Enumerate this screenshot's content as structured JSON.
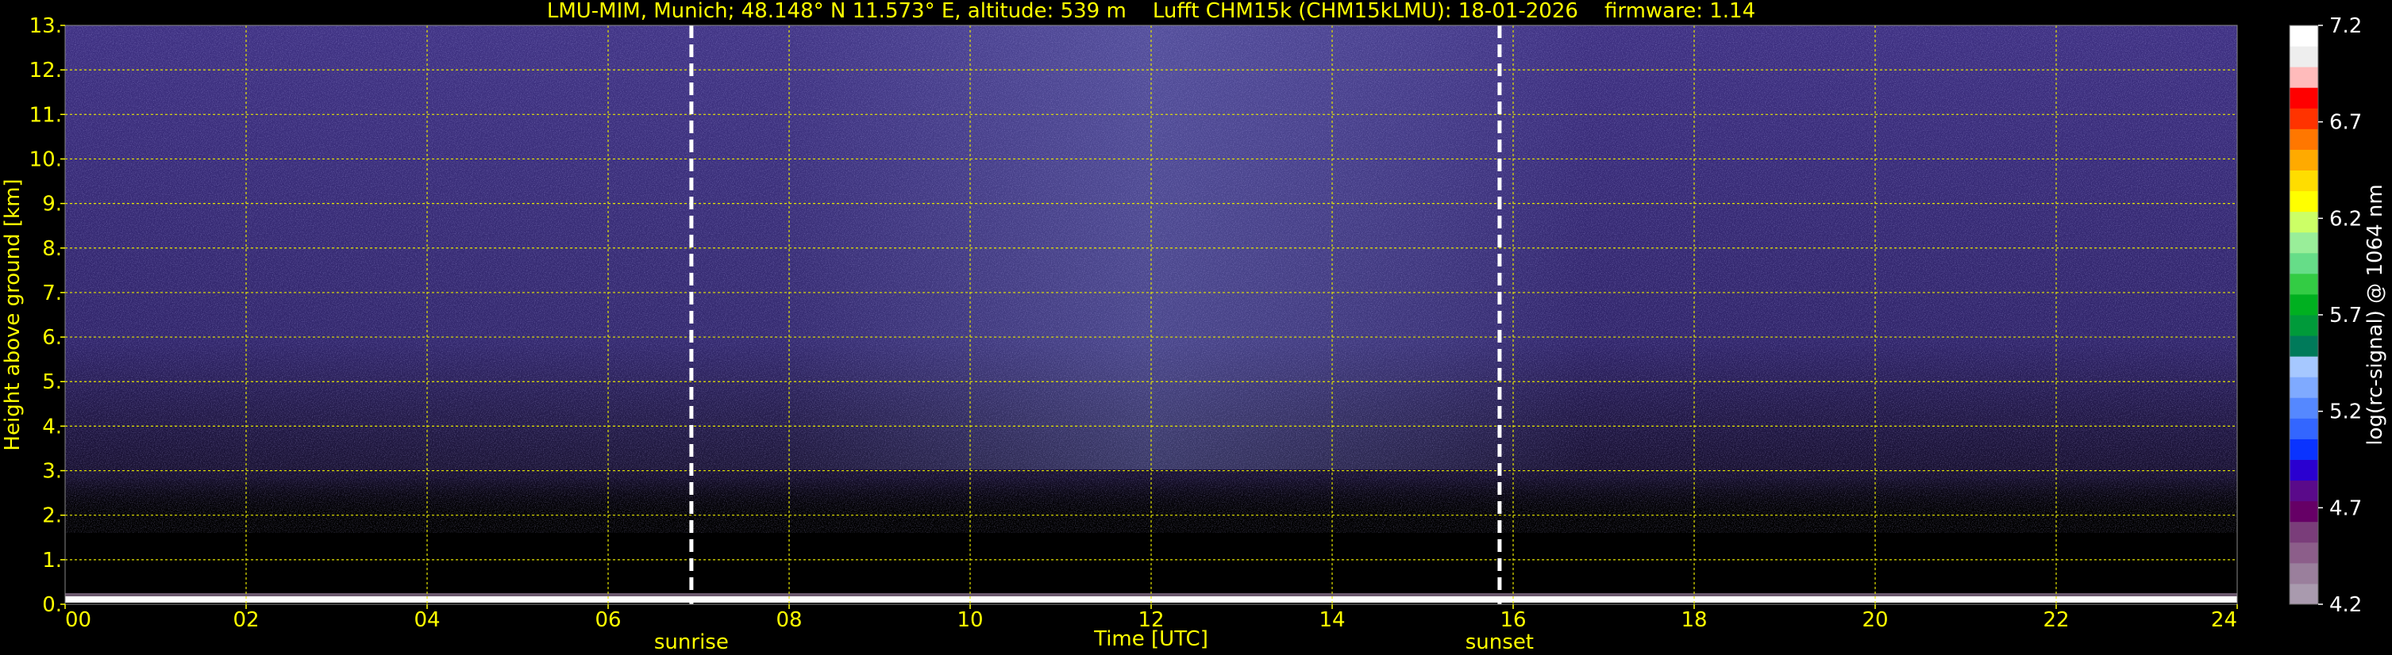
{
  "chart_data": {
    "type": "heatmap",
    "title": "LMU-MIM, Munich; 48.148° N 11.573° E, altitude: 539 m    Lufft CHM15k (CHM15kLMU): 18-01-2026    firmware: 1.14",
    "xlabel": "Time [UTC]",
    "ylabel": "Height above ground [km]",
    "xlim": [
      0,
      24
    ],
    "ylim": [
      0,
      13
    ],
    "x_ticks": [
      0,
      2,
      4,
      6,
      8,
      10,
      12,
      14,
      16,
      18,
      20,
      22,
      24
    ],
    "x_tick_labels": [
      "00",
      "02",
      "04",
      "06",
      "08",
      "10",
      "12",
      "14",
      "16",
      "18",
      "20",
      "22",
      "24"
    ],
    "y_ticks": [
      0,
      1,
      2,
      3,
      4,
      5,
      6,
      7,
      8,
      9,
      10,
      11,
      12,
      13
    ],
    "y_tick_labels": [
      "0.",
      "1.",
      "2.",
      "3.",
      "4.",
      "5.",
      "6.",
      "7.",
      "8.",
      "9.",
      "10.",
      "11.",
      "12.",
      "13."
    ],
    "grid": true,
    "colorbar": {
      "label": "log(rc-signal) @ 1064 nm",
      "range": [
        4.2,
        7.2
      ],
      "ticks": [
        4.2,
        4.7,
        5.2,
        5.7,
        6.2,
        6.7,
        7.2
      ],
      "tick_labels": [
        "4.2",
        "4.7",
        "5.2",
        "5.7",
        "6.2",
        "6.7",
        "7.2"
      ],
      "colors": [
        "#a99aae",
        "#9a7f9c",
        "#8c5e8a",
        "#7a3d7a",
        "#660066",
        "#5a0a8a",
        "#2a00d0",
        "#0a33ff",
        "#3366ff",
        "#5588ff",
        "#7faaff",
        "#a6c8ff",
        "#007a5a",
        "#009a3a",
        "#00b020",
        "#33cc44",
        "#66dd88",
        "#99ee99",
        "#ccff66",
        "#ffff00",
        "#ffdd00",
        "#ffaa00",
        "#ff7700",
        "#ff3300",
        "#ff0000",
        "#ffbbbb",
        "#eeeeee",
        "#ffffff"
      ]
    },
    "markers": [
      {
        "label": "sunrise",
        "x": 6.92
      },
      {
        "label": "sunset",
        "x": 15.85
      }
    ],
    "field_description": "background noise purple/blue, strongest aloft between about 09 and 15 UTC; strong near-surface signal below about 0.15 km"
  }
}
